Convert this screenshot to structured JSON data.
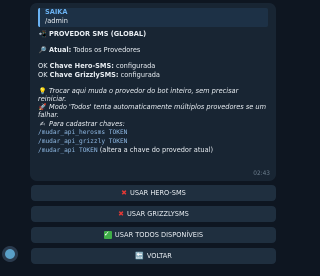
{
  "message": {
    "reply_author": "SAIKA",
    "reply_text": "/admin",
    "title": "PROVEDOR SMS (GLOBAL)",
    "current_label": "Atual:",
    "current_value": "Todos os Provedores",
    "hero_prefix": "OK",
    "hero_name": "Chave Hero-SMS:",
    "hero_status": "configurada",
    "grizzly_prefix": "OK",
    "grizzly_name": "Chave GrizzlySMS:",
    "grizzly_status": "configurada",
    "tip_text": "Trocar aqui muda o provedor do bot inteiro, sem precisar reiniciar.",
    "mode_text": "Modo 'Todos' tenta automaticamente múltiplos provedores se um falhar.",
    "register_label": "Para cadastrar chaves:",
    "cmd1": "/mudar_api_herosms TOKEN",
    "cmd2": "/mudar_api_grizzly TOKEN",
    "cmd3_code": "/mudar_api TOKEN",
    "cmd3_note": "(altera a chave do provedor atual)",
    "time": "02:43",
    "icons": [
      "phone-icon",
      "search-icon",
      "lightbulb-icon",
      "rocket-icon",
      "writing-hand-icon"
    ]
  },
  "buttons": [
    {
      "label": "USAR HERO-SMS",
      "icon": "red-x-icon"
    },
    {
      "label": "USAR GRIZZLYSMS",
      "icon": "red-x-icon"
    },
    {
      "label": "USAR TODOS DISPONÍVEIS",
      "icon": "green-check-icon"
    },
    {
      "label": "VOLTAR",
      "icon": "back-arrow-icon"
    }
  ],
  "colors": {
    "background": "#0e1621",
    "bubble": "#182533",
    "accent": "#6ab2f2",
    "button": "#1f2f3f"
  }
}
